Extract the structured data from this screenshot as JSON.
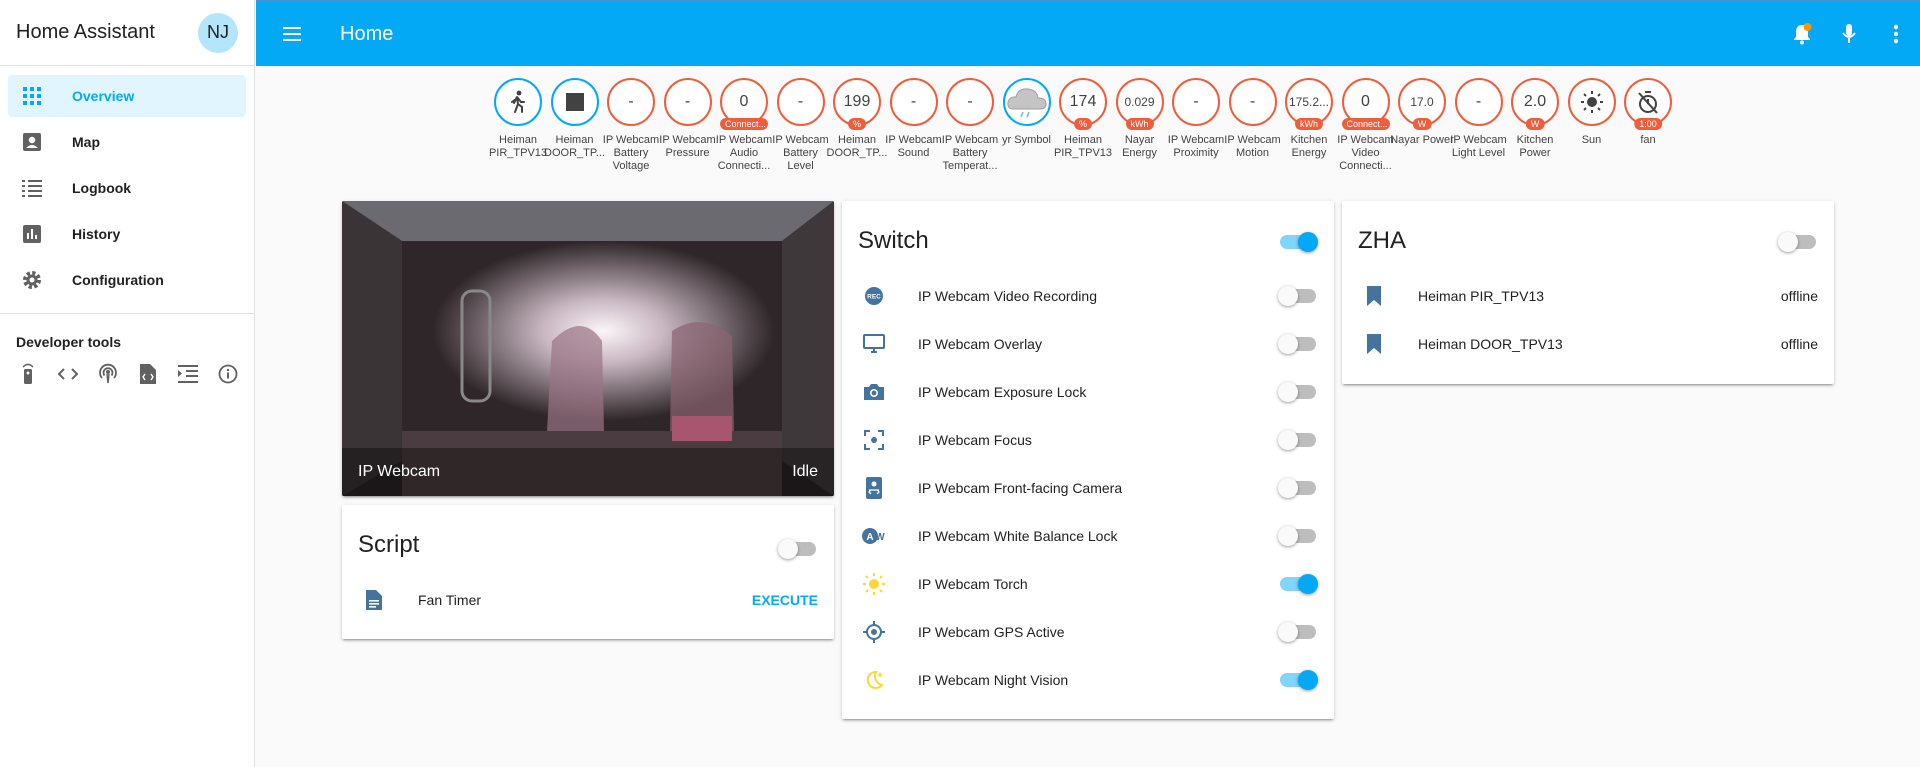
{
  "app": {
    "title": "Home Assistant",
    "avatar_initials": "NJ"
  },
  "sidebar": {
    "items": [
      {
        "label": "Overview",
        "icon": "view-dashboard-icon",
        "active": true
      },
      {
        "label": "Map",
        "icon": "account-box-icon"
      },
      {
        "label": "Logbook",
        "icon": "format-list-bulleted-icon"
      },
      {
        "label": "History",
        "icon": "chart-box-icon"
      },
      {
        "label": "Configuration",
        "icon": "cog-icon"
      }
    ],
    "developer_tools_title": "Developer tools",
    "developer_tools": [
      "remote-icon",
      "code-tags-icon",
      "radio-tower-icon",
      "file-code-icon",
      "format-indent-icon",
      "information-outline-icon"
    ]
  },
  "header": {
    "title": "Home"
  },
  "badges": [
    {
      "value": "",
      "icon": "walk-icon",
      "label": "Heiman PIR_TPV13",
      "ring": "blue"
    },
    {
      "value": "",
      "icon": "square-icon",
      "label": "Heiman DOOR_TP...",
      "ring": "blue"
    },
    {
      "value": "-",
      "label": "IP Webcam Battery Voltage"
    },
    {
      "value": "-",
      "label": "IP Webcam Pressure"
    },
    {
      "value": "0",
      "unit": "Connect...",
      "label": "IP Webcam Audio Connecti..."
    },
    {
      "value": "-",
      "label": "IP Webcam Battery Level"
    },
    {
      "value": "199",
      "unit": "%",
      "label": "Heiman DOOR_TP..."
    },
    {
      "value": "-",
      "label": "IP Webcam Sound"
    },
    {
      "value": "-",
      "label": "IP Webcam Battery Temperat..."
    },
    {
      "value": "",
      "icon": "weather-cloudy-icon",
      "label": "yr Symbol",
      "ring": "blue"
    },
    {
      "value": "174",
      "unit": "%",
      "label": "Heiman PIR_TPV13"
    },
    {
      "value": "0.029",
      "unit": "kWh",
      "label": "Nayar Energy"
    },
    {
      "value": "-",
      "label": "IP Webcam Proximity"
    },
    {
      "value": "-",
      "label": "IP Webcam Motion"
    },
    {
      "value": "175.2...",
      "unit": "kWh",
      "label": "Kitchen Energy"
    },
    {
      "value": "0",
      "unit": "Connect...",
      "label": "IP Webcam Video Connecti..."
    },
    {
      "value": "17.0",
      "unit": "W",
      "label": "Nayar Power"
    },
    {
      "value": "-",
      "label": "IP Webcam Light Level"
    },
    {
      "value": "2.0",
      "unit": "W",
      "label": "Kitchen Power"
    },
    {
      "value": "",
      "icon": "white-balance-sunny-icon",
      "label": "Sun"
    },
    {
      "value": "",
      "icon": "timer-off-icon",
      "unit": "1:00",
      "label": "fan"
    }
  ],
  "camera": {
    "name": "IP Webcam",
    "state": "Idle"
  },
  "script_card": {
    "title": "Script",
    "toggle_on": false,
    "rows": [
      {
        "label": "Fan Timer",
        "icon": "file-document-icon",
        "action": "EXECUTE"
      }
    ]
  },
  "switch_card": {
    "title": "Switch",
    "toggle_on": true,
    "rows": [
      {
        "label": "IP Webcam Video Recording",
        "icon": "record-rec-icon",
        "on": false
      },
      {
        "label": "IP Webcam Overlay",
        "icon": "monitor-icon",
        "on": false
      },
      {
        "label": "IP Webcam Exposure Lock",
        "icon": "camera-icon",
        "on": false
      },
      {
        "label": "IP Webcam Focus",
        "icon": "focus-icon",
        "on": false
      },
      {
        "label": "IP Webcam Front-facing Camera",
        "icon": "camera-front-icon",
        "on": false
      },
      {
        "label": "IP Webcam White Balance Lock",
        "icon": "white-balance-auto-icon",
        "on": false
      },
      {
        "label": "IP Webcam Torch",
        "icon": "white-balance-sunny-icon",
        "on": true
      },
      {
        "label": "IP Webcam GPS Active",
        "icon": "crosshairs-gps-icon",
        "on": false
      },
      {
        "label": "IP Webcam Night Vision",
        "icon": "weather-night-icon",
        "on": true
      }
    ]
  },
  "zha_card": {
    "title": "ZHA",
    "toggle_on": false,
    "rows": [
      {
        "label": "Heiman PIR_TPV13",
        "icon": "bookmark-icon",
        "state": "offline"
      },
      {
        "label": "Heiman DOOR_TPV13",
        "icon": "bookmark-icon",
        "state": "offline"
      }
    ]
  },
  "colors": {
    "primary": "#03a9f4",
    "badge_ring": "#ef5e3c",
    "icon": "#44739e",
    "active_icon": "#fdd835"
  }
}
